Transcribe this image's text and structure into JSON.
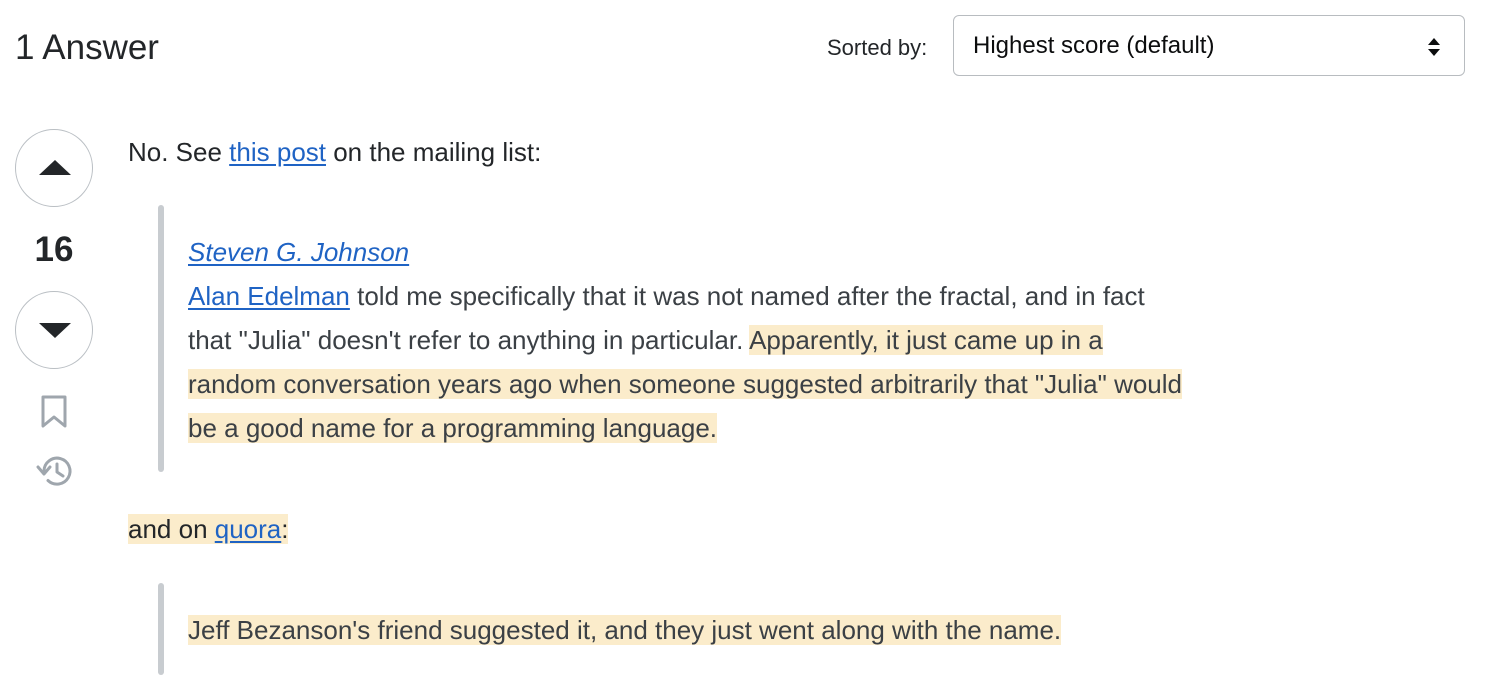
{
  "header": {
    "answers_count_label": "1 Answer",
    "sort_label": "Sorted by:",
    "sort_value": "Highest score (default)"
  },
  "vote": {
    "score": "16"
  },
  "post": {
    "intro_prefix": "No. See ",
    "intro_link": "this post",
    "intro_suffix": " on the mailing list:",
    "quote1": {
      "author": "Steven G. Johnson",
      "person_link": "Alan Edelman",
      "line1_rest": " told me specifically that it was not named after the fractal, and in fact",
      "line2_plain": "that \"Julia\" doesn't refer to anything in particular. ",
      "line2_highlight": "Apparently, it just came up in a",
      "line3": "random conversation years ago when someone suggested arbitrarily that \"Julia\" would",
      "line4": "be a good name for a programming language."
    },
    "second_prefix": "and on ",
    "second_link": "quora",
    "second_suffix": ":",
    "quote2": {
      "text": "Jeff Bezanson's friend suggested it, and they just went along with the name."
    }
  },
  "colors": {
    "link": "#1f63c4",
    "highlight": "#fbeccb",
    "quote_bar": "#c8ccd0",
    "text": "#232629"
  }
}
